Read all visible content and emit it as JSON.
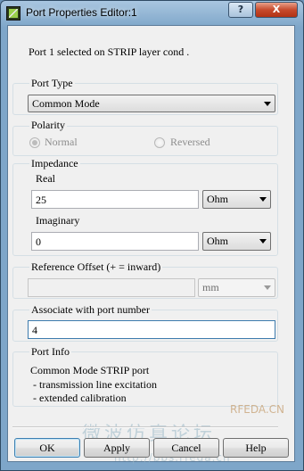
{
  "window": {
    "title": "Port Properties Editor:1",
    "help_glyph": "?",
    "close_glyph": "X"
  },
  "selection_info": "Port 1 selected on STRIP layer cond .",
  "port_type": {
    "label": "Port Type",
    "value": "Common Mode"
  },
  "polarity": {
    "label": "Polarity",
    "normal": "Normal",
    "reversed": "Reversed",
    "selected": "Normal"
  },
  "impedance": {
    "label": "Impedance",
    "real": {
      "label": "Real",
      "value": "25",
      "unit": "Ohm"
    },
    "imaginary": {
      "label": "Imaginary",
      "value": "0",
      "unit": "Ohm"
    }
  },
  "reference_offset": {
    "label": "Reference Offset (+ = inward)",
    "value": "",
    "unit": "mm"
  },
  "associate": {
    "label": "Associate with port number",
    "value": "4"
  },
  "port_info": {
    "label": "Port Info",
    "lines": [
      "Common Mode STRIP port",
      " - transmission line excitation",
      " - extended calibration"
    ]
  },
  "buttons": {
    "ok": "OK",
    "apply": "Apply",
    "cancel": "Cancel",
    "help": "Help"
  },
  "watermark": {
    "site": "RFEDA.CN",
    "cjk": "微波仿真论坛",
    "url": "http://bbs.rfeda.cn"
  }
}
